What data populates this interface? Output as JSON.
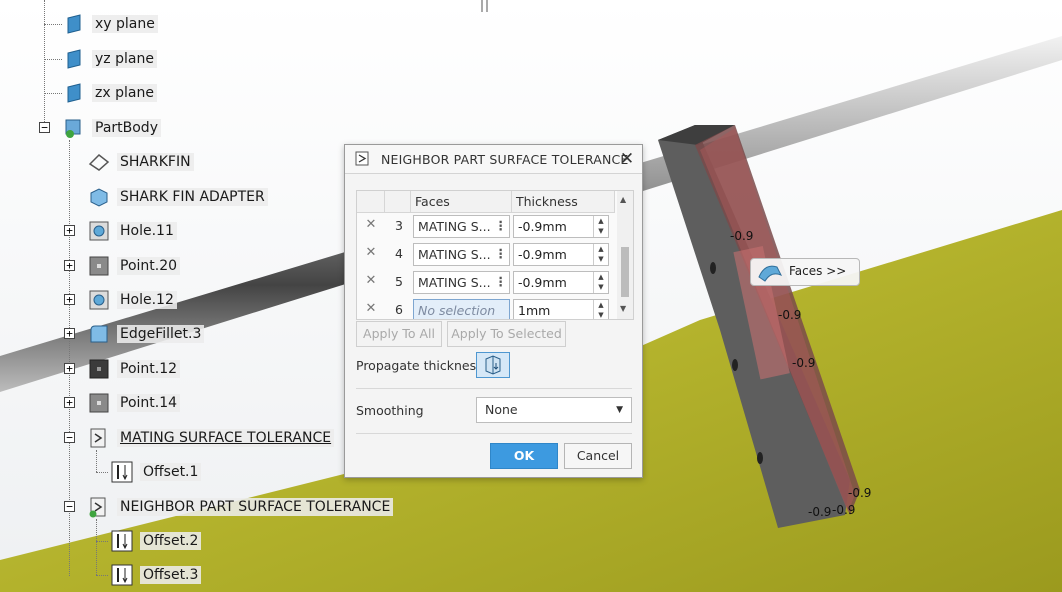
{
  "tree": {
    "items": [
      {
        "label": "xy plane",
        "icon": "plane-icon"
      },
      {
        "label": "yz plane",
        "icon": "plane-icon"
      },
      {
        "label": "zx plane",
        "icon": "plane-icon"
      },
      {
        "label": "PartBody",
        "icon": "part-body-icon"
      },
      {
        "label": "SHARKFIN",
        "icon": "sketch-icon"
      },
      {
        "label": "SHARK FIN ADAPTER",
        "icon": "solid-icon"
      },
      {
        "label": "Hole.11",
        "icon": "hole-icon"
      },
      {
        "label": "Point.20",
        "icon": "point-icon"
      },
      {
        "label": "Hole.12",
        "icon": "hole-icon"
      },
      {
        "label": "EdgeFillet.3",
        "icon": "edge-fillet-icon"
      },
      {
        "label": "Point.12",
        "icon": "point-icon"
      },
      {
        "label": "Point.14",
        "icon": "point-icon"
      },
      {
        "label": "MATING SURFACE TOLERANCE",
        "icon": "tolerance-icon"
      },
      {
        "label": "Offset.1",
        "icon": "offset-icon"
      },
      {
        "label": "NEIGHBOR PART SURFACE TOLERANCE",
        "icon": "tolerance-icon"
      },
      {
        "label": "Offset.2",
        "icon": "offset-icon"
      },
      {
        "label": "Offset.3",
        "icon": "offset-icon"
      }
    ]
  },
  "dialog": {
    "title": "NEIGHBOR PART SURFACE TOLERANCE",
    "close_glyph": "✕",
    "columns": {
      "faces": "Faces",
      "thickness": "Thickness"
    },
    "rows": [
      {
        "index": "3",
        "faces": "MATING S...",
        "thickness": "-0.9mm"
      },
      {
        "index": "4",
        "faces": "MATING S...",
        "thickness": "-0.9mm"
      },
      {
        "index": "5",
        "faces": "MATING S...",
        "thickness": "-0.9mm"
      },
      {
        "index": "6",
        "faces": "No selection",
        "thickness": "1mm"
      }
    ],
    "apply_to_all": "Apply To All",
    "apply_to_selected": "Apply To Selected",
    "propagate_label": "Propagate thickness",
    "smoothing_label": "Smoothing",
    "smoothing_value": "None",
    "ok": "OK",
    "cancel": "Cancel"
  },
  "viewport": {
    "faces_tag": "Faces >>",
    "dims": [
      "-0.9",
      "-0.9",
      "-0.9",
      "-0.9",
      "-0.9",
      "-0.9"
    ]
  },
  "colors": {
    "accent": "#3d9ae0",
    "ground": "#b9b92e",
    "part_highlight": "#a85a5a"
  }
}
